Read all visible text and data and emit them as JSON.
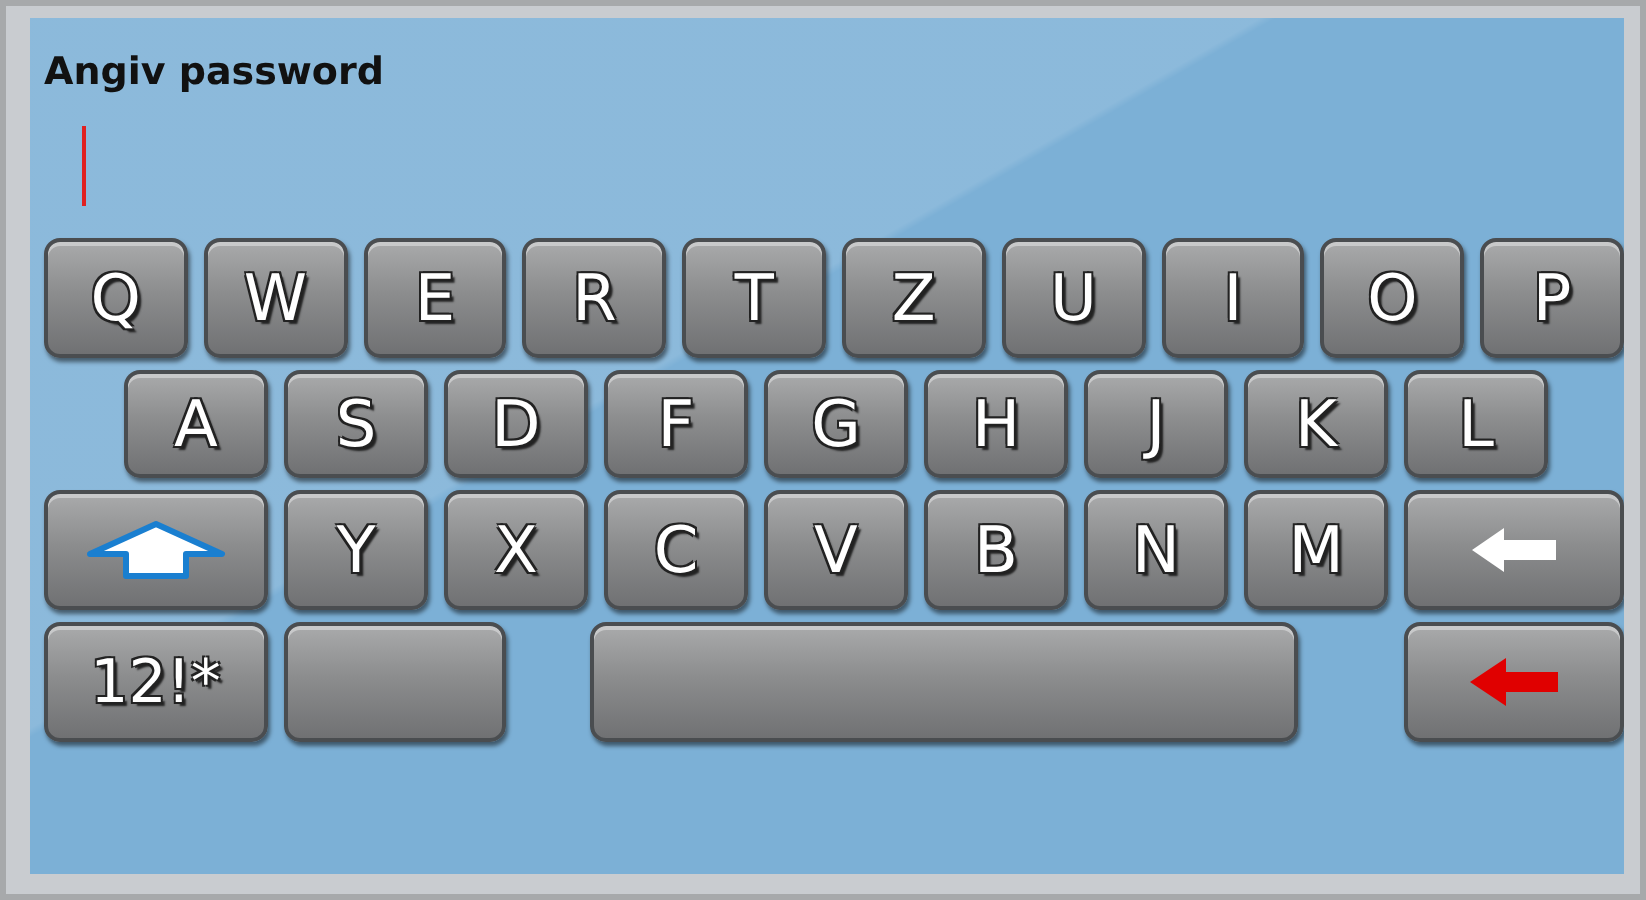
{
  "title": "Angiv password",
  "password_field": {
    "cursor": true
  },
  "keyboard": {
    "rows": [
      {
        "keys": [
          {
            "kind": "char",
            "label": "Q"
          },
          {
            "kind": "char",
            "label": "W"
          },
          {
            "kind": "char",
            "label": "E"
          },
          {
            "kind": "char",
            "label": "R"
          },
          {
            "kind": "char",
            "label": "T"
          },
          {
            "kind": "char",
            "label": "Z"
          },
          {
            "kind": "char",
            "label": "U"
          },
          {
            "kind": "char",
            "label": "I"
          },
          {
            "kind": "char",
            "label": "O"
          },
          {
            "kind": "char",
            "label": "P"
          }
        ]
      },
      {
        "keys": [
          {
            "kind": "char",
            "label": "A"
          },
          {
            "kind": "char",
            "label": "S"
          },
          {
            "kind": "char",
            "label": "D"
          },
          {
            "kind": "char",
            "label": "F"
          },
          {
            "kind": "char",
            "label": "G"
          },
          {
            "kind": "char",
            "label": "H"
          },
          {
            "kind": "char",
            "label": "J"
          },
          {
            "kind": "char",
            "label": "K"
          },
          {
            "kind": "char",
            "label": "L"
          }
        ]
      },
      {
        "keys": [
          {
            "kind": "shift"
          },
          {
            "kind": "char",
            "label": "Y"
          },
          {
            "kind": "char",
            "label": "X"
          },
          {
            "kind": "char",
            "label": "C"
          },
          {
            "kind": "char",
            "label": "V"
          },
          {
            "kind": "char",
            "label": "B"
          },
          {
            "kind": "char",
            "label": "N"
          },
          {
            "kind": "char",
            "label": "M"
          },
          {
            "kind": "backspace"
          }
        ]
      },
      {
        "keys": [
          {
            "kind": "mode",
            "label": "12!*"
          },
          {
            "kind": "blank"
          },
          {
            "kind": "space"
          },
          {
            "kind": "enter"
          }
        ]
      }
    ]
  }
}
